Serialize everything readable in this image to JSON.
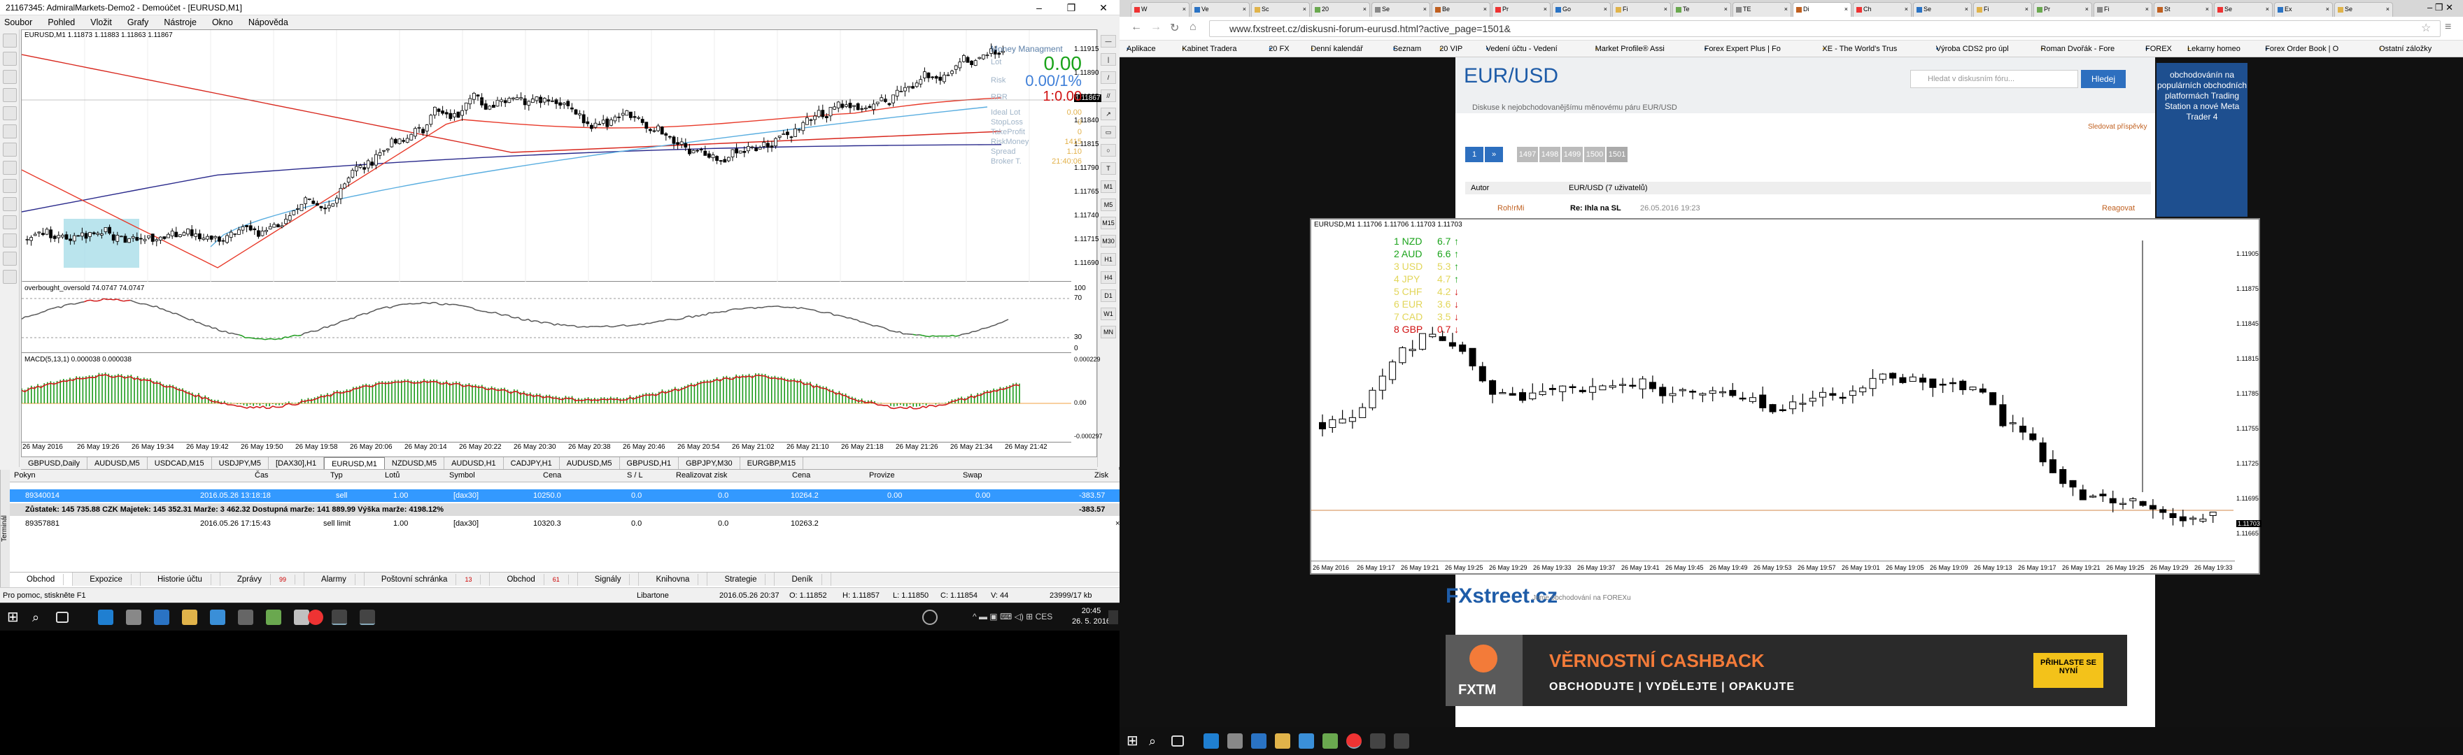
{
  "mt4": {
    "title": "21167345: AdmiralMarkets-Demo2 - Demoúčet - [EURUSD,M1]",
    "menu": [
      "Soubor",
      "Pohled",
      "Vložit",
      "Grafy",
      "Nástroje",
      "Okno",
      "Nápověda"
    ],
    "main_chart_label": "EURUSD,M1  1.11873 1.11883 1.11863 1.11867",
    "osc_label": "overbought_oversold 74.0747 74.0747",
    "macd_label": "MACD(5,13,1) 0.000038 0.000038",
    "price_ticks": [
      "1.11915",
      "1.11890",
      "1.11865",
      "1.11840",
      "1.11815",
      "1.11790",
      "1.11765",
      "1.11740",
      "1.11715",
      "1.11690"
    ],
    "current_price": "1.11867",
    "osc_ticks": [
      "100",
      "70",
      "30",
      "0"
    ],
    "macd_ticks": [
      "0.000229",
      "0.00",
      "-0.000297"
    ],
    "money_mgmt": {
      "title": "Money Managment",
      "lot_label": "Lot",
      "lot": "0.00",
      "risk_label": "Risk",
      "risk": "0.00/1%",
      "rrr_label": "RRR",
      "rrr": "1:0.00",
      "ideal_lot_label": "Ideal Lot",
      "ideal_lot": "0.00",
      "stoploss_label": "StopLoss",
      "stoploss": "0",
      "takeprofit_label": "TakeProfit",
      "takeprofit": "0",
      "riskmoney_label": "RiskMoney",
      "riskmoney": "1415",
      "spread_label": "Spread",
      "spread": "1.10",
      "brokertime_label": "Broker T.",
      "brokertime": "21:40:06"
    },
    "time_ticks": [
      "26 May 2016",
      "26 May 19:26",
      "26 May 19:34",
      "26 May 19:42",
      "26 May 19:50",
      "26 May 19:58",
      "26 May 20:06",
      "26 May 20:14",
      "26 May 20:22",
      "26 May 20:30",
      "26 May 20:38",
      "26 May 20:46",
      "26 May 20:54",
      "26 May 21:02",
      "26 May 21:10",
      "26 May 21:18",
      "26 May 21:26",
      "26 May 21:34",
      "26 May 21:42"
    ],
    "chart_tabs": [
      "GBPUSD,Daily",
      "AUDUSD,M5",
      "USDCAD,M15",
      "USDJPY,M5",
      "[DAX30],H1",
      "EURUSD,M1",
      "NZDUSD,M5",
      "AUDUSD,H1",
      "CADJPY,H1",
      "AUDUSD,M5",
      "GBPUSD,H1",
      "GBPJPY,M30",
      "EURGBP,M15"
    ],
    "active_chart_tab": "EURUSD,M1",
    "terminal": {
      "side_label": "Terminál",
      "headers": [
        "Pokyn",
        "Čas",
        "Typ",
        "Lotů",
        "Symbol",
        "Cena",
        "S / L",
        "Realizovat zisk",
        "Cena",
        "Provize",
        "Swap",
        "Zisk"
      ],
      "row1": {
        "order": "89340014",
        "time": "2016.05.26 13:18:18",
        "type": "sell",
        "lots": "1.00",
        "symbol": "[dax30]",
        "price": "10250.0",
        "sl": "0.0",
        "tp": "0.0",
        "cur": "10264.2",
        "comm": "0.00",
        "swap": "0.00",
        "profit": "-383.57"
      },
      "balance": {
        "text": "Zůstatek: 145 735.88 CZK  Majetek: 145 352.31  Marže: 3 462.32  Dostupná marže: 141 889.99  Výška marže: 4198.12%",
        "profit": "-383.57"
      },
      "row2": {
        "order": "89357881",
        "time": "2016.05.26 17:15:43",
        "type": "sell limit",
        "lots": "1.00",
        "symbol": "[dax30]",
        "price": "10320.3",
        "sl": "0.0",
        "tp": "0.0",
        "cur": "10263.2"
      },
      "tabs": [
        {
          "label": "Obchod",
          "n": ""
        },
        {
          "label": "Expozice",
          "n": ""
        },
        {
          "label": "Historie účtu",
          "n": ""
        },
        {
          "label": "Zprávy",
          "n": "99"
        },
        {
          "label": "Alarmy",
          "n": ""
        },
        {
          "label": "Poštovní schránka",
          "n": "13"
        },
        {
          "label": "Obchod",
          "n": "61"
        },
        {
          "label": "Signály",
          "n": ""
        },
        {
          "label": "Knihovna",
          "n": ""
        },
        {
          "label": "Strategie",
          "n": ""
        },
        {
          "label": "Deník",
          "n": ""
        }
      ]
    },
    "status": {
      "help": "Pro pomoc, stiskněte F1",
      "profile": "Libartone",
      "datetime": "2016.05.26 20:37",
      "o": "O: 1.11852",
      "h": "H: 1.11857",
      "l": "L: 1.11850",
      "c": "C: 1.11854",
      "v": "V: 44",
      "traffic": "23999/17 kb"
    }
  },
  "taskbar": {
    "time": "20:45",
    "date": "26. 5. 2016"
  },
  "browser": {
    "tabs": [
      "W",
      "Ve",
      "Sc",
      "20",
      "Se",
      "Be",
      "Pr",
      "Go",
      "Fi",
      "Te",
      "TE",
      "Di",
      "Ch",
      "Se",
      "Fi",
      "Pr",
      "Fi",
      "St",
      "Se",
      "Ex",
      "Se"
    ],
    "url": "www.fxstreet.cz/diskusni-forum-eurusd.html?active_page=1501&",
    "bookmarks": [
      "Aplikace",
      "Kabinet Tradera",
      "20 FX",
      "Denní kalendář",
      "Seznam",
      "20 VIP",
      "Vedení účtu - Vedení",
      "Market Profile® Assi",
      "Forex Expert Plus | Fo",
      "XE - The World's Trus",
      "Výroba CDS2 pro úpl",
      "Roman Dvořák - Fore",
      "FOREX",
      "Lekarny homeo",
      "Forex Order Book | O",
      "Ostatní záložky"
    ],
    "page": {
      "title": "EUR/USD",
      "subtitle": "Diskuse k nejobchodovanějšímu měnovému páru EUR/USD",
      "search_placeholder": "Hledat v diskusním fóru...",
      "search_button": "Hledej",
      "side_ad": "obchodovánín na populárních obchodních platformách Trading Station a nové Meta Trader 4",
      "post_author": "Autor",
      "post_header": "EUR/USD (7 uživatelů)",
      "post_user": "Roh!rMi",
      "post_title": "Re: Ihla na SL",
      "post_time": "26.05.2016 19:23",
      "post_reply": "Reagovat",
      "watch": "Sledovat příspěvky",
      "logo": "FXstreet.cz",
      "logo_sub": "Jsme obchodování na FOREXu",
      "banner_title": "VĚRNOSTNÍ CASHBACK",
      "banner_sub": "OBCHODUJTE | VYDĚLEJTE | OPAKUJTE",
      "banner_btn": "PŘIHLASTE SE NYNÍ",
      "banner_brand": "FXTM",
      "pager": [
        "1",
        "»",
        "1497",
        "1498",
        "1499",
        "1500",
        "1501"
      ]
    },
    "inner_chart": {
      "label": "EURUSD,M1  1.11706 1.11706 1.11703 1.11703",
      "price_ticks": [
        "1.11905",
        "1.11875",
        "1.11845",
        "1.11815",
        "1.11785",
        "1.11755",
        "1.11725",
        "1.11695",
        "1.11665"
      ],
      "current_price": "1.11703",
      "time_ticks": [
        "26 May 2016",
        "26 May 19:17",
        "26 May 19:21",
        "26 May 19:25",
        "26 May 19:29",
        "26 May 19:33",
        "26 May 19:37",
        "26 May 19:41",
        "26 May 19:45",
        "26 May 19:49",
        "26 May 19:53",
        "26 May 19:57",
        "26 May 19:01",
        "26 May 19:05",
        "26 May 19:09",
        "26 May 19:13",
        "26 May 19:17",
        "26 May 19:21",
        "26 May 19:25",
        "26 May 19:29",
        "26 May 19:33"
      ],
      "strength": [
        {
          "label": "1 NZD",
          "val": "6.7",
          "color": "#1aa31a",
          "arrow": "↑",
          "acolor": "#1aa31a"
        },
        {
          "label": "2 AUD",
          "val": "6.6",
          "color": "#1aa31a",
          "arrow": "↑",
          "acolor": "#1aa31a"
        },
        {
          "label": "3 USD",
          "val": "5.3",
          "color": "#e2d65a",
          "arrow": "↑",
          "acolor": "#1aa31a"
        },
        {
          "label": "4 JPY",
          "val": "4.7",
          "color": "#e2d65a",
          "arrow": "↑",
          "acolor": "#1aa31a"
        },
        {
          "label": "5 CHF",
          "val": "4.2",
          "color": "#e2d65a",
          "arrow": "↓",
          "acolor": "#d01010"
        },
        {
          "label": "6 EUR",
          "val": "3.6",
          "color": "#e2d65a",
          "arrow": "↓",
          "acolor": "#d01010"
        },
        {
          "label": "7 CAD",
          "val": "3.5",
          "color": "#e2d65a",
          "arrow": "↓",
          "acolor": "#d01010"
        },
        {
          "label": "8 GBP",
          "val": "0.7",
          "color": "#d01010",
          "arrow": "↓",
          "acolor": "#d01010"
        }
      ]
    }
  }
}
